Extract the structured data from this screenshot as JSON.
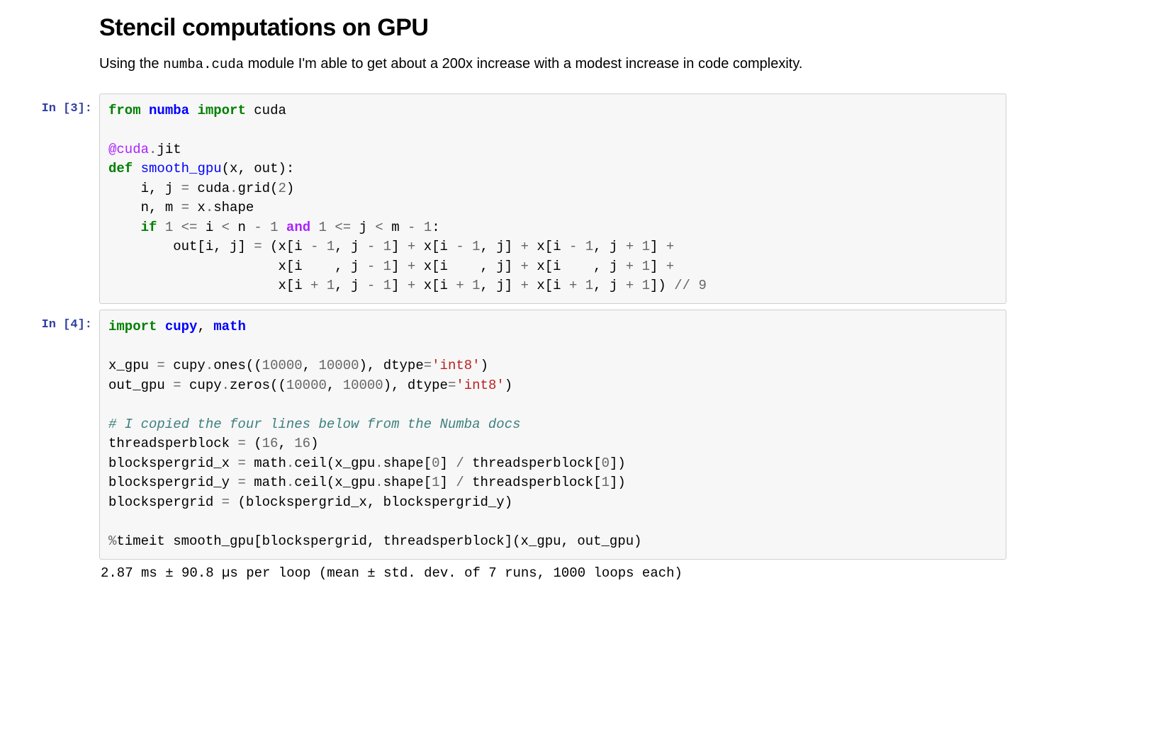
{
  "heading": "Stencil computations on GPU",
  "intro_pre": "Using the ",
  "intro_code": "numba.cuda",
  "intro_post": " module I'm able to get about a 200x increase with a modest increase in code complexity.",
  "cells": [
    {
      "prompt": "In [3]:",
      "code_html": "<span class=\"kn\">from</span> <span class=\"nn\">numba</span> <span class=\"kn\">import</span> cuda\n\n<span class=\"nd\">@cuda</span><span class=\"o\">.</span>jit\n<span class=\"k\">def</span> <span class=\"nf\">smooth_gpu</span>(x, out):\n    i, j <span class=\"o\">=</span> cuda<span class=\"o\">.</span>grid(<span class=\"mi\">2</span>)\n    n, m <span class=\"o\">=</span> x<span class=\"o\">.</span>shape\n    <span class=\"k\">if</span> <span class=\"mi\">1</span> <span class=\"o\">&lt;=</span> i <span class=\"o\">&lt;</span> n <span class=\"o\">-</span> <span class=\"mi\">1</span> <span class=\"ow\">and</span> <span class=\"mi\">1</span> <span class=\"o\">&lt;=</span> j <span class=\"o\">&lt;</span> m <span class=\"o\">-</span> <span class=\"mi\">1</span>:\n        out[i, j] <span class=\"o\">=</span> (x[i <span class=\"o\">-</span> <span class=\"mi\">1</span>, j <span class=\"o\">-</span> <span class=\"mi\">1</span>] <span class=\"o\">+</span> x[i <span class=\"o\">-</span> <span class=\"mi\">1</span>, j] <span class=\"o\">+</span> x[i <span class=\"o\">-</span> <span class=\"mi\">1</span>, j <span class=\"o\">+</span> <span class=\"mi\">1</span>] <span class=\"o\">+</span>\n                     x[i    , j <span class=\"o\">-</span> <span class=\"mi\">1</span>] <span class=\"o\">+</span> x[i    , j] <span class=\"o\">+</span> x[i    , j <span class=\"o\">+</span> <span class=\"mi\">1</span>] <span class=\"o\">+</span>\n                     x[i <span class=\"o\">+</span> <span class=\"mi\">1</span>, j <span class=\"o\">-</span> <span class=\"mi\">1</span>] <span class=\"o\">+</span> x[i <span class=\"o\">+</span> <span class=\"mi\">1</span>, j] <span class=\"o\">+</span> x[i <span class=\"o\">+</span> <span class=\"mi\">1</span>, j <span class=\"o\">+</span> <span class=\"mi\">1</span>]) <span class=\"o\">//</span> <span class=\"mi\">9</span>"
    },
    {
      "prompt": "In [4]:",
      "code_html": "<span class=\"kn\">import</span> <span class=\"nn\">cupy</span>, <span class=\"nn\">math</span>\n\nx_gpu <span class=\"o\">=</span> cupy<span class=\"o\">.</span>ones((<span class=\"mi\">10000</span>, <span class=\"mi\">10000</span>), dtype<span class=\"o\">=</span><span class=\"s\">'int8'</span>)\nout_gpu <span class=\"o\">=</span> cupy<span class=\"o\">.</span>zeros((<span class=\"mi\">10000</span>, <span class=\"mi\">10000</span>), dtype<span class=\"o\">=</span><span class=\"s\">'int8'</span>)\n\n<span class=\"c\"># I copied the four lines below from the Numba docs</span>\nthreadsperblock <span class=\"o\">=</span> (<span class=\"mi\">16</span>, <span class=\"mi\">16</span>)\nblockspergrid_x <span class=\"o\">=</span> math<span class=\"o\">.</span>ceil(x_gpu<span class=\"o\">.</span>shape[<span class=\"mi\">0</span>] <span class=\"o\">/</span> threadsperblock[<span class=\"mi\">0</span>])\nblockspergrid_y <span class=\"o\">=</span> math<span class=\"o\">.</span>ceil(x_gpu<span class=\"o\">.</span>shape[<span class=\"mi\">1</span>] <span class=\"o\">/</span> threadsperblock[<span class=\"mi\">1</span>])\nblockspergrid <span class=\"o\">=</span> (blockspergrid_x, blockspergrid_y)\n\n<span class=\"o\">%</span><span class=\"mg\">timeit</span> smooth_gpu[blockspergrid, threadsperblock](x_gpu, out_gpu)",
      "output": "2.87 ms ± 90.8 µs per loop (mean ± std. dev. of 7 runs, 1000 loops each)"
    }
  ]
}
